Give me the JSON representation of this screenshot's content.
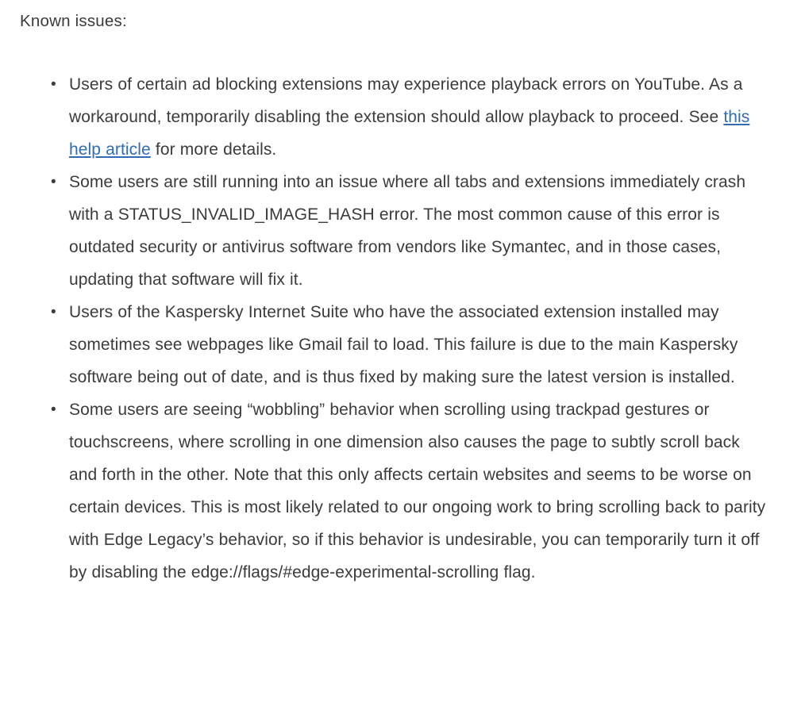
{
  "document": {
    "heading": "Known issues:",
    "text_color": "#3b3b3b",
    "background_color": "#ffffff",
    "link_color": "#2f6cb5",
    "bullet_glyph": "•"
  },
  "issues": [
    {
      "id": "adblock-youtube-playback",
      "text_before_link": "Users of certain ad blocking extensions may experience playback errors on YouTube.  As a workaround, temporarily disabling the extension should allow playback to proceed.  See ",
      "link_text": "this help article",
      "text_after_link": " for more details."
    },
    {
      "id": "status-invalid-image-hash",
      "text_before_link": "Some users are still running into an issue where all tabs and extensions immediately crash with a STATUS_INVALID_IMAGE_HASH error.  The most common cause of this error is outdated security or antivirus software from vendors like Symantec, and in those cases, updating that software will fix it.",
      "link_text": "",
      "text_after_link": ""
    },
    {
      "id": "kaspersky-gmail-load-failure",
      "text_before_link": "Users of the Kaspersky Internet Suite who have the associated extension installed may sometimes see webpages like Gmail fail to load.  This failure is due to the main Kaspersky software being out of date, and is thus fixed by making sure the latest version is installed.",
      "link_text": "",
      "text_after_link": ""
    },
    {
      "id": "scroll-wobbling-trackpad",
      "text_before_link": "Some users are seeing “wobbling” behavior when scrolling using trackpad gestures or touchscreens, where scrolling in one dimension also causes the page to subtly scroll back and forth in the other.  Note that this only affects certain websites and seems to be worse on certain devices.  This is most likely related to our ongoing work to bring scrolling back to parity with Edge Legacy’s behavior, so if this behavior is undesirable, you can temporarily turn it off by disabling the edge://flags/#edge-experimental-scrolling flag.",
      "link_text": "",
      "text_after_link": ""
    }
  ]
}
